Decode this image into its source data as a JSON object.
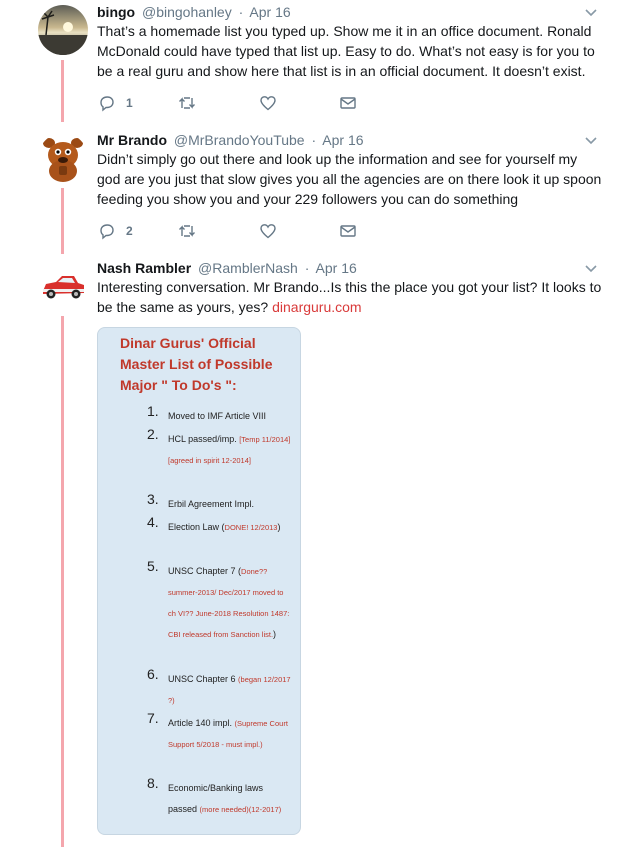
{
  "tweets": [
    {
      "name": "bingo",
      "handle": "@bingohanley",
      "dot": "·",
      "date": "Apr 16",
      "text": "That’s a homemade list you typed up. Show me it in an office document. Ronald McDonald could have typed that list up. Easy to do. What’s not easy is for you to be a real guru and show here that list is in an official document. It doesn’t exist.",
      "reply_count": "1",
      "retweet_count": "",
      "like_count": ""
    },
    {
      "name": "Mr Brando",
      "handle": "@MrBrandoYouTube",
      "dot": "·",
      "date": "Apr 16",
      "text": "Didn’t simply go out there and look up the information and see for yourself my god are you just that slow gives you all the agencies are on there look it up spoon feeding you show you and your 229 followers you can do something",
      "reply_count": "2",
      "retweet_count": "",
      "like_count": ""
    },
    {
      "name": "Nash Rambler",
      "handle": "@RamblerNash",
      "dot": "·",
      "date": "Apr 16",
      "text": "Interesting conversation. Mr Brando...Is this the place you got your list? It looks to be the same as yours, yes?",
      "link": "dinarguru.com"
    }
  ],
  "card": {
    "title": "Dinar Gurus' Official Master List of Possible Major \" To Do's \":",
    "items": [
      {
        "num": "1.",
        "text": "Moved to IMF Article VIII",
        "note": "",
        "tail": ""
      },
      {
        "num": "2.",
        "text": "HCL passed/imp.",
        "note": "[Temp 11/2014] [agreed in spirit 12-2014]",
        "tail": ""
      },
      {
        "num": "3.",
        "text": "Erbil Agreement Impl.",
        "note": "",
        "tail": ""
      },
      {
        "num": "4.",
        "text": "Election Law (",
        "note": "DONE! 12/2013",
        "tail": ")"
      },
      {
        "num": "5.",
        "text": "UNSC Chapter 7 (",
        "note": "Done?? summer-2013/ Dec/2017 moved to ch VI?? June-2018 Resolution 1487: CBI released from Sanction list.",
        "tail": ")"
      },
      {
        "num": "6.",
        "text": "UNSC Chapter 6",
        "note": "(began 12/2017 ?)",
        "tail": ""
      },
      {
        "num": "7.",
        "text": "Article 140 impl.",
        "note": "(Supreme Court Support 5/2018 - must impl.)",
        "tail": ""
      },
      {
        "num": "8.",
        "text": "Economic/Banking laws passed",
        "note": "(more needed)(12-2017)",
        "tail": ""
      }
    ]
  },
  "colors": {
    "thread_line": "#f4a6ad",
    "link": "#d93a3a",
    "card_bg": "#dae8f3",
    "card_title": "#c0392b",
    "muted": "#657786"
  },
  "icons": [
    "reply-icon",
    "retweet-icon",
    "like-icon",
    "direct-message-icon",
    "chevron-down-icon"
  ]
}
